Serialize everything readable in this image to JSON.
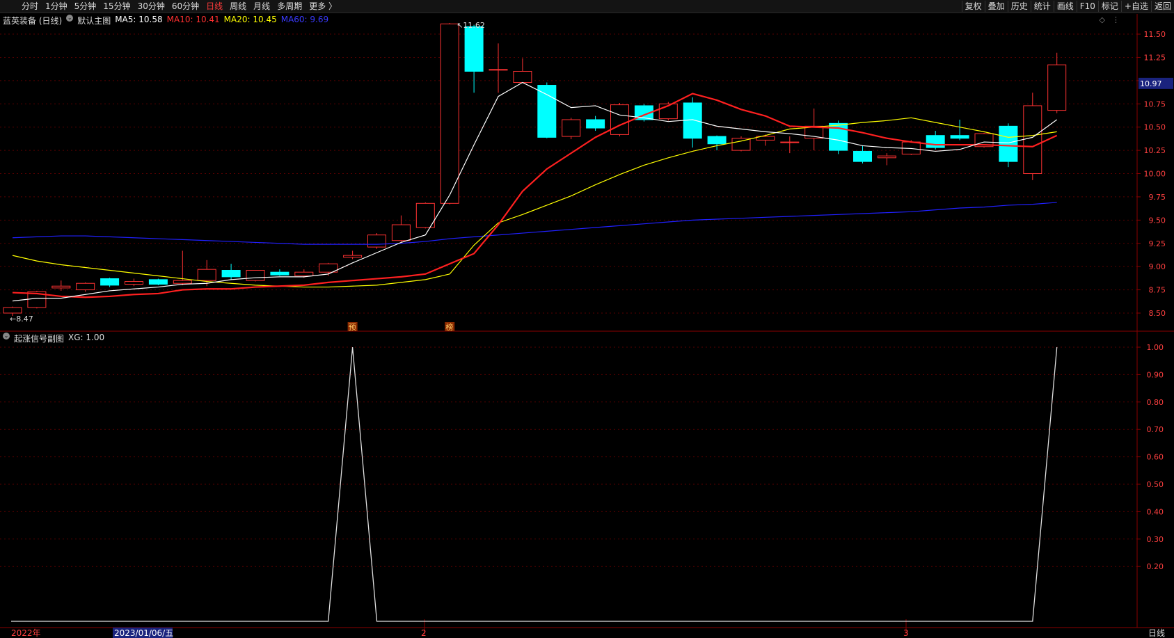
{
  "topbar": {
    "periods": [
      "分时",
      "1分钟",
      "5分钟",
      "15分钟",
      "30分钟",
      "60分钟",
      "日线",
      "周线",
      "月线",
      "多周期",
      "更多 〉"
    ],
    "active_period": "日线",
    "right_buttons": [
      "复权",
      "叠加",
      "历史",
      "统计",
      "画线",
      "F10",
      "标记",
      "+自选",
      "返回"
    ]
  },
  "main_legend": {
    "stock": "蓝英装备 (日线)",
    "chart_name": "默认主图",
    "ma5": "MA5: 10.58",
    "ma10": "MA10: 10.41",
    "ma20": "MA20: 10.45",
    "ma60": "MA60: 9.69"
  },
  "sub_legend": {
    "name": "起涨信号副图",
    "xg": "XG: 1.00"
  },
  "markers": {
    "high_label": "11.62",
    "low_label": "8.47",
    "current_price": "10.97",
    "tag1": "预",
    "tag2": "榜"
  },
  "bottom": {
    "year_label": "2022年",
    "cursor_date": "2023/01/06/五",
    "month2": "2",
    "month3": "3",
    "period_label": "日线"
  },
  "colors": {
    "up": "#ff3232",
    "down": "#00ffff",
    "ma5": "#ffffff",
    "ma10": "#ff2020",
    "ma20": "#ffff00",
    "ma60": "#2020ff",
    "axis": "#8b0000"
  },
  "chart_data": [
    {
      "type": "candlestick",
      "title": "",
      "y_ticks": [
        8.5,
        8.75,
        9.0,
        9.25,
        9.5,
        9.75,
        10.0,
        10.25,
        10.5,
        10.75,
        11.0,
        11.25,
        11.5
      ],
      "ylim": [
        8.43,
        11.67
      ],
      "candles": [
        {
          "o": 8.5,
          "c": 8.56,
          "h": 8.57,
          "l": 8.47
        },
        {
          "o": 8.56,
          "c": 8.73,
          "h": 8.74,
          "l": 8.55
        },
        {
          "o": 8.77,
          "c": 8.79,
          "h": 8.85,
          "l": 8.74
        },
        {
          "o": 8.75,
          "c": 8.82,
          "h": 8.83,
          "l": 8.73
        },
        {
          "o": 8.87,
          "c": 8.8,
          "h": 8.88,
          "l": 8.78
        },
        {
          "o": 8.81,
          "c": 8.84,
          "h": 8.87,
          "l": 8.79
        },
        {
          "o": 8.86,
          "c": 8.81,
          "h": 8.87,
          "l": 8.8
        },
        {
          "o": 8.82,
          "c": 8.85,
          "h": 9.17,
          "l": 8.8
        },
        {
          "o": 8.85,
          "c": 8.97,
          "h": 9.07,
          "l": 8.79
        },
        {
          "o": 8.96,
          "c": 8.89,
          "h": 9.03,
          "l": 8.86
        },
        {
          "o": 8.85,
          "c": 8.96,
          "h": 8.96,
          "l": 8.84
        },
        {
          "o": 8.94,
          "c": 8.91,
          "h": 8.97,
          "l": 8.9
        },
        {
          "o": 8.9,
          "c": 8.94,
          "h": 8.97,
          "l": 8.88
        },
        {
          "o": 8.94,
          "c": 9.03,
          "h": 9.04,
          "l": 8.9
        },
        {
          "o": 9.1,
          "c": 9.12,
          "h": 9.17,
          "l": 9.08
        },
        {
          "o": 9.21,
          "c": 9.34,
          "h": 9.36,
          "l": 9.19
        },
        {
          "o": 9.28,
          "c": 9.45,
          "h": 9.55,
          "l": 9.26
        },
        {
          "o": 9.42,
          "c": 9.68,
          "h": 9.69,
          "l": 9.41
        },
        {
          "o": 9.68,
          "c": 11.61,
          "h": 11.62,
          "l": 9.67
        },
        {
          "o": 11.58,
          "c": 11.1,
          "h": 11.6,
          "l": 10.87
        },
        {
          "o": 11.12,
          "c": 11.12,
          "h": 11.4,
          "l": 10.87
        },
        {
          "o": 10.98,
          "c": 11.1,
          "h": 11.24,
          "l": 10.98
        },
        {
          "o": 10.95,
          "c": 10.39,
          "h": 10.98,
          "l": 10.38
        },
        {
          "o": 10.4,
          "c": 10.58,
          "h": 10.6,
          "l": 10.37
        },
        {
          "o": 10.58,
          "c": 10.49,
          "h": 10.62,
          "l": 10.46
        },
        {
          "o": 10.42,
          "c": 10.74,
          "h": 10.76,
          "l": 10.4
        },
        {
          "o": 10.73,
          "c": 10.58,
          "h": 10.75,
          "l": 10.56
        },
        {
          "o": 10.59,
          "c": 10.75,
          "h": 10.77,
          "l": 10.57
        },
        {
          "o": 10.76,
          "c": 10.38,
          "h": 10.82,
          "l": 10.28
        },
        {
          "o": 10.4,
          "c": 10.32,
          "h": 10.41,
          "l": 10.25
        },
        {
          "o": 10.25,
          "c": 10.38,
          "h": 10.4,
          "l": 10.24
        },
        {
          "o": 10.36,
          "c": 10.4,
          "h": 10.42,
          "l": 10.3
        },
        {
          "o": 10.34,
          "c": 10.34,
          "h": 10.4,
          "l": 10.22
        },
        {
          "o": 10.38,
          "c": 10.51,
          "h": 10.7,
          "l": 10.25
        },
        {
          "o": 10.54,
          "c": 10.25,
          "h": 10.57,
          "l": 10.21
        },
        {
          "o": 10.24,
          "c": 10.13,
          "h": 10.3,
          "l": 10.11
        },
        {
          "o": 10.17,
          "c": 10.19,
          "h": 10.22,
          "l": 10.09
        },
        {
          "o": 10.21,
          "c": 10.34,
          "h": 10.36,
          "l": 10.2
        },
        {
          "o": 10.41,
          "c": 10.28,
          "h": 10.46,
          "l": 10.26
        },
        {
          "o": 10.41,
          "c": 10.38,
          "h": 10.58,
          "l": 10.36
        },
        {
          "o": 10.29,
          "c": 10.43,
          "h": 10.44,
          "l": 10.28
        },
        {
          "o": 10.51,
          "c": 10.13,
          "h": 10.54,
          "l": 10.07
        },
        {
          "o": 10.0,
          "c": 10.73,
          "h": 10.87,
          "l": 9.93
        },
        {
          "o": 10.68,
          "c": 11.17,
          "h": 11.3,
          "l": 10.65
        }
      ],
      "ma5": [
        8.63,
        8.66,
        8.66,
        8.7,
        8.74,
        8.76,
        8.78,
        8.81,
        8.82,
        8.86,
        8.88,
        8.89,
        8.89,
        8.92,
        9.04,
        9.15,
        9.26,
        9.34,
        9.77,
        10.31,
        10.83,
        10.98,
        10.85,
        10.71,
        10.73,
        10.63,
        10.6,
        10.56,
        10.58,
        10.51,
        10.48,
        10.45,
        10.43,
        10.4,
        10.36,
        10.3,
        10.28,
        10.27,
        10.24,
        10.26,
        10.34,
        10.33,
        10.39,
        10.58
      ],
      "ma10": [
        8.72,
        8.71,
        8.68,
        8.67,
        8.68,
        8.7,
        8.71,
        8.75,
        8.76,
        8.76,
        8.78,
        8.79,
        8.8,
        8.83,
        8.85,
        8.87,
        8.89,
        8.92,
        9.03,
        9.14,
        9.45,
        9.81,
        10.05,
        10.22,
        10.39,
        10.52,
        10.63,
        10.73,
        10.86,
        10.79,
        10.69,
        10.62,
        10.51,
        10.5,
        10.49,
        10.44,
        10.38,
        10.34,
        10.31,
        10.31,
        10.31,
        10.3,
        10.29,
        10.41
      ],
      "ma20": [
        9.12,
        9.06,
        9.02,
        8.99,
        8.96,
        8.93,
        8.9,
        8.87,
        8.84,
        8.82,
        8.8,
        8.79,
        8.78,
        8.78,
        8.79,
        8.8,
        8.83,
        8.86,
        8.92,
        9.23,
        9.47,
        9.56,
        9.66,
        9.76,
        9.88,
        9.99,
        10.09,
        10.17,
        10.24,
        10.3,
        10.35,
        10.41,
        10.48,
        10.5,
        10.52,
        10.55,
        10.57,
        10.6,
        10.55,
        10.5,
        10.45,
        10.39,
        10.41,
        10.45
      ],
      "ma60": [
        9.31,
        9.32,
        9.33,
        9.33,
        9.32,
        9.31,
        9.3,
        9.29,
        9.28,
        9.27,
        9.26,
        9.25,
        9.24,
        9.24,
        9.24,
        9.24,
        9.25,
        9.27,
        9.3,
        9.32,
        9.34,
        9.36,
        9.38,
        9.4,
        9.42,
        9.44,
        9.46,
        9.48,
        9.5,
        9.51,
        9.52,
        9.53,
        9.54,
        9.55,
        9.56,
        9.57,
        9.58,
        9.59,
        9.61,
        9.63,
        9.64,
        9.66,
        9.67,
        9.69
      ]
    },
    {
      "type": "line",
      "title": "起涨信号副图",
      "y_ticks": [
        0.2,
        0.3,
        0.4,
        0.5,
        0.6,
        0.7,
        0.8,
        0.9,
        1.0
      ],
      "ylim": [
        0,
        1
      ],
      "values": [
        0,
        0,
        0,
        0,
        0,
        0,
        0,
        0,
        0,
        0,
        0,
        0,
        0,
        0,
        1,
        0,
        0,
        0,
        0,
        0,
        0,
        0,
        0,
        0,
        0,
        0,
        0,
        0,
        0,
        0,
        0,
        0,
        0,
        0,
        0,
        0,
        0,
        0,
        0,
        0,
        0,
        0,
        0,
        1
      ]
    }
  ]
}
